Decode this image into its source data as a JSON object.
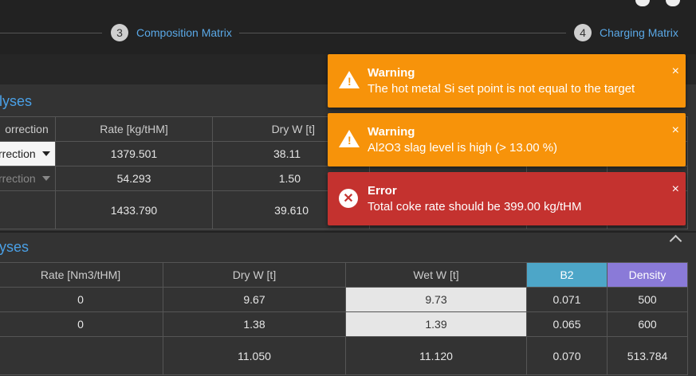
{
  "stepper": {
    "step3": {
      "num": "3",
      "label": "Composition Matrix"
    },
    "step4": {
      "num": "4",
      "label": "Charging Matrix"
    }
  },
  "section1": {
    "title": "lyses",
    "headers": [
      "orrection",
      "Rate [kg/tHM]",
      "Dry W [t]"
    ],
    "rows": [
      {
        "sel": "rrection",
        "rate": "1379.501",
        "dry": "38.11"
      },
      {
        "sel": "rrection",
        "rate": "54.293",
        "dry": "1.50"
      }
    ],
    "totals": {
      "rate": "1433.790",
      "dry": "39.610"
    }
  },
  "section2": {
    "title": "yses",
    "headers": [
      "Rate [Nm3/tHM]",
      "Dry W [t]",
      "Wet W [t]",
      "B2",
      "Density"
    ],
    "rows": [
      {
        "rate": "0",
        "dry": "9.67",
        "wet": "9.73",
        "b2": "0.071",
        "density": "500"
      },
      {
        "rate": "0",
        "dry": "1.38",
        "wet": "1.39",
        "b2": "0.065",
        "density": "600"
      }
    ],
    "totals": {
      "dry": "11.050",
      "wet": "11.120",
      "b2": "0.070",
      "density": "513.784"
    }
  },
  "toasts": [
    {
      "type": "warning",
      "title": "Warning",
      "message": "The hot metal Si set point is not equal to the target",
      "close": "×"
    },
    {
      "type": "warning",
      "title": "Warning",
      "message": "Al2O3 slag level is high (> 13.00 %)",
      "close": "×"
    },
    {
      "type": "error",
      "title": "Error",
      "message": "Total coke rate should be 399.00 kg/tHM",
      "close": "×"
    }
  ],
  "colors": {
    "warning": "#f7930a",
    "error": "#c4322f",
    "accent": "#4aa0e6",
    "b2": "#4da6c8",
    "density": "#8a7ad8"
  },
  "icons": [
    "help-icon",
    "settings-icon",
    "warning-icon",
    "error-icon",
    "close-icon",
    "chevron-up-icon",
    "caret-down-icon"
  ]
}
